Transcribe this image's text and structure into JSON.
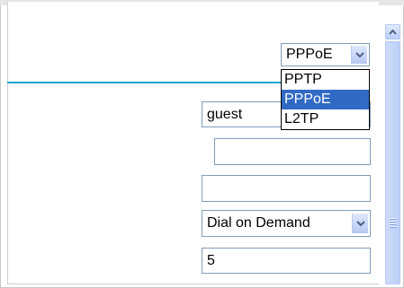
{
  "connection_type": {
    "selected": "PPPoE",
    "options": [
      "PPTP",
      "PPPoE",
      "L2TP"
    ],
    "highlighted": "PPPoE"
  },
  "username_field": {
    "value": "guest"
  },
  "password_field": {
    "value": ""
  },
  "service_name_field": {
    "value": ""
  },
  "connect_mode": {
    "selected": "Dial on Demand"
  },
  "idle_time_field": {
    "value": "5"
  },
  "colors": {
    "accent_line": "#1ea4d8",
    "selection": "#316ac5"
  }
}
